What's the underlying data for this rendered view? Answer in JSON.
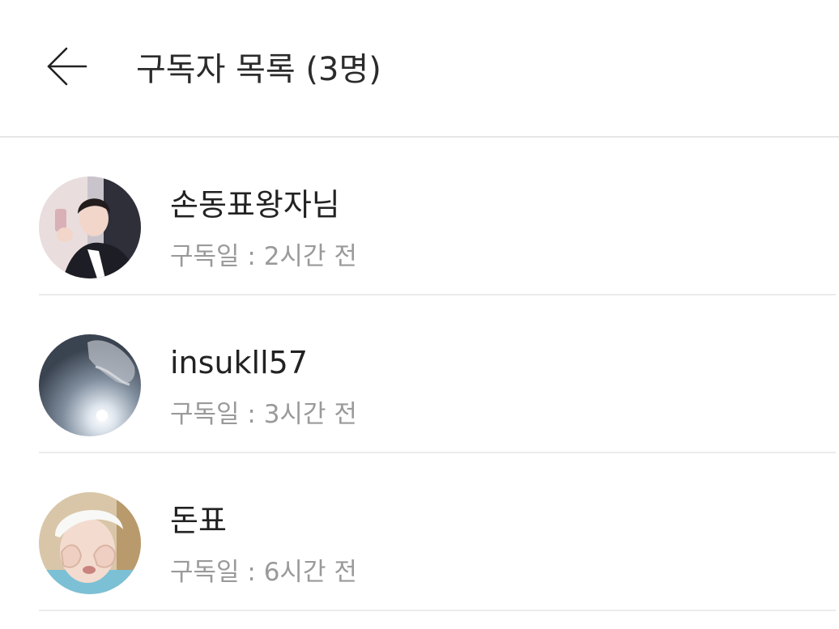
{
  "header": {
    "back_icon": "arrow-left-icon",
    "title": "구독자 목록 (3명)"
  },
  "subscribers": [
    {
      "name": "손동표왕자님",
      "subscribed_label": "구독일 : 2시간 전",
      "avatar_icon": "profile-photo"
    },
    {
      "name": "insukll57",
      "subscribed_label": "구독일 : 3시간 전",
      "avatar_icon": "profile-photo"
    },
    {
      "name": "돈표",
      "subscribed_label": "구독일 : 6시간 전",
      "avatar_icon": "profile-photo"
    }
  ],
  "colors": {
    "text_primary": "#222222",
    "text_secondary": "#9a9a9a",
    "divider": "#ebebeb",
    "background": "#ffffff"
  }
}
